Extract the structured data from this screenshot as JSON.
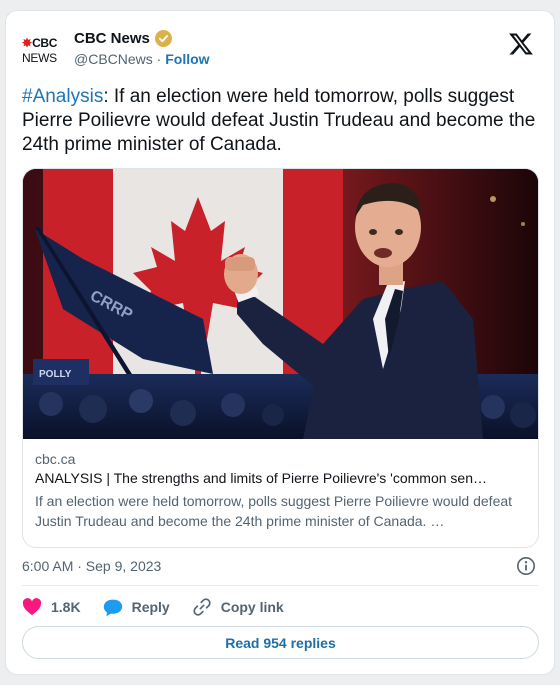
{
  "account": {
    "logo_gem": "✸",
    "logo_cbc": "CBC",
    "logo_news": "NEWS",
    "name": "CBC News",
    "handle": "@CBCNews",
    "separator": "·",
    "follow_label": "Follow"
  },
  "tweet": {
    "hashtag": "#Analysis",
    "text": ": If an election were held tomorrow, polls suggest Pierre Poilievre would defeat Justin Trudeau and become the 24th prime minister of Canada."
  },
  "link_card": {
    "domain": "cbc.ca",
    "title": "ANALYSIS | The strengths and limits of Pierre Poilievre's 'common sen…",
    "description": "If an election were held tomorrow, polls suggest Pierre Poilievre would defeat Justin Trudeau and become the 24th prime minister of Canada. …",
    "image_icon": "photo-politician-fist-raised-canadian-flag"
  },
  "meta": {
    "timestamp": "6:00 AM · Sep 9, 2023"
  },
  "actions": {
    "like_count": "1.8K",
    "reply_label": "Reply",
    "copy_label": "Copy link",
    "read_replies_label": "Read 954 replies"
  },
  "colors": {
    "accent": "#1d75b6",
    "heart": "#f91880",
    "verified": "#d9b34a",
    "cbc_red": "#e0201c"
  }
}
